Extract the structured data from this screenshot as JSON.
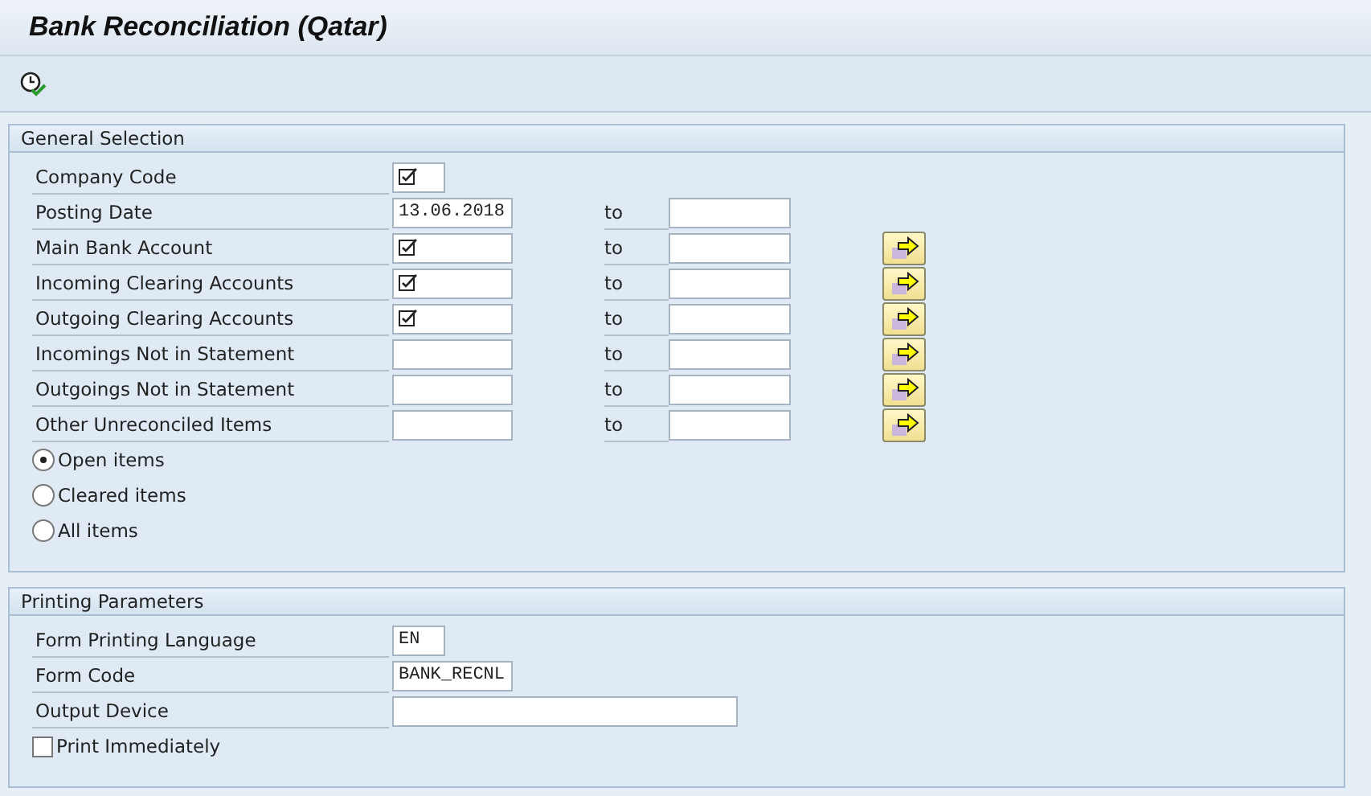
{
  "window": {
    "title": "Bank Reconciliation (Qatar)"
  },
  "general_selection": {
    "title": "General Selection",
    "rows": [
      {
        "label": "Company Code",
        "kind": "tiny",
        "required": true,
        "multiple_button": false
      },
      {
        "label": "Posting Date",
        "kind": "medium",
        "value": "13.06.2018",
        "required": false,
        "to_label": "to",
        "multiple_button": false
      },
      {
        "label": "Main Bank Account",
        "kind": "medium",
        "required": true,
        "to_label": "to",
        "multiple_button": true
      },
      {
        "label": "Incoming Clearing Accounts",
        "kind": "medium",
        "required": true,
        "to_label": "to",
        "multiple_button": true
      },
      {
        "label": "Outgoing Clearing Accounts",
        "kind": "medium",
        "required": true,
        "to_label": "to",
        "multiple_button": true
      },
      {
        "label": "Incomings Not in Statement",
        "kind": "medium",
        "required": false,
        "to_label": "to",
        "multiple_button": true
      },
      {
        "label": "Outgoings Not in Statement",
        "kind": "medium",
        "required": false,
        "to_label": "to",
        "multiple_button": true
      },
      {
        "label": "Other Unreconciled Items",
        "kind": "medium",
        "required": false,
        "to_label": "to",
        "multiple_button": true
      }
    ],
    "radios": [
      {
        "label": "Open items",
        "selected": true
      },
      {
        "label": "Cleared items",
        "selected": false
      },
      {
        "label": "All items",
        "selected": false
      }
    ]
  },
  "printing_parameters": {
    "title": "Printing Parameters",
    "rows": [
      {
        "label": "Form Printing Language",
        "kind": "tiny",
        "value": "EN"
      },
      {
        "label": "Form Code",
        "kind": "medium",
        "value": "BANK_RECNL"
      },
      {
        "label": "Output Device",
        "kind": "long"
      }
    ],
    "checkbox": {
      "label": "Print Immediately",
      "checked": false
    }
  }
}
